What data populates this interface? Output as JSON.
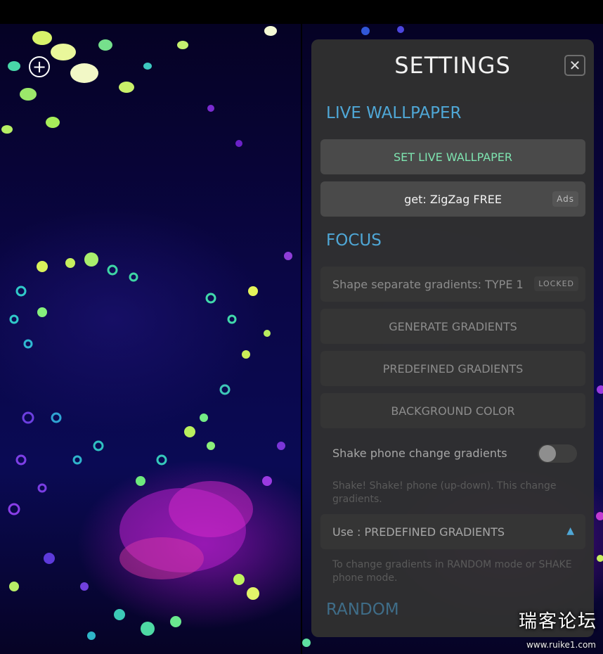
{
  "left_screen": {
    "add_icon": "plus-circle-icon",
    "add_label": "+"
  },
  "settings": {
    "title": "SETTINGS",
    "close_label": "✕",
    "sections": {
      "live_wallpaper": {
        "title": "LIVE WALLPAPER",
        "set_button": "SET LIVE WALLPAPER",
        "get_button": "get: ZigZag FREE",
        "ads_badge": "Ads"
      },
      "focus": {
        "title": "FOCUS",
        "shape_row": "Shape separate gradients: TYPE 1",
        "locked_badge": "LOCKED",
        "generate_button": "GENERATE GRADIENTS",
        "predefined_button": "PREDEFINED GRADIENTS",
        "background_button": "BACKGROUND COLOR",
        "shake_label": "Shake phone change gradients",
        "shake_enabled": false,
        "shake_hint": "Shake! Shake! phone (up-down). This change gradients.",
        "use_select": "Use : PREDEFINED GRADIENTS",
        "use_hint": "To change gradients in RANDOM mode or SHAKE phone mode."
      },
      "random": {
        "title": "RANDOM"
      }
    }
  },
  "watermark": {
    "text": "瑞客论坛",
    "url": "www.ruike1.com"
  },
  "colors": {
    "accent": "#4fa7d6",
    "panel": "#303030",
    "green_text": "#7ee4b0"
  }
}
